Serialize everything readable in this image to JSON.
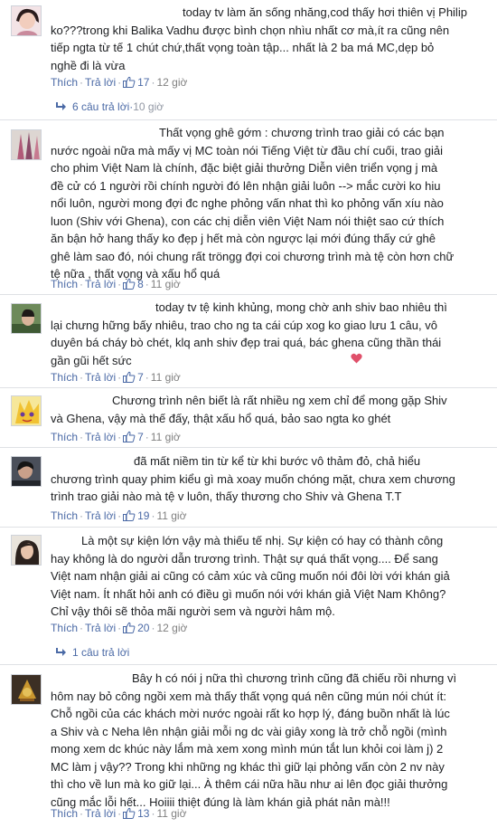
{
  "comments": [
    {
      "text": "today tv làm ăn sống nhăng,cod thấy hơi thiên vị Philip\nko???trong khi Balika Vadhu được bình chọn nhìu nhất cơ mà,ít ra cũng nên\ntiếp ngta từ tế 1 chút chứ,thất vọng toàn tập... nhất là 2 ba má MC,dẹp bỏ\nnghề đi là vừa",
      "like": "Thích",
      "reply": "Trả lời",
      "likes": "17",
      "time": "12 giờ",
      "replies": "6 câu trả lời",
      "replies_time": "10 giờ"
    },
    {
      "text": "Thất vọng ghê gớm : chương trình trao giải có các bạn\nnước ngoài nữa mà mấy vị MC toàn nói Tiếng Việt từ đầu chí cuối, trao giải\ncho phim Việt Nam là chính, đặc biệt giải thưởng Diễn viên triển vọng j mà\nđề cử có 1 người rồi chính người đó lên nhận giải luôn --> mắc cười ko hiu\nnổi luôn, người mong đợi đc nghe phỏng vấn nhat thì ko phỏng vấn xíu nào\nluon (Shiv với Ghena), con các chị diễn viên Việt Nam nói thiệt sao cứ thích\năn bận hở hang thấy ko đẹp j hết mà còn ngược lại mới đúng thấy cứ ghê\nghê làm sao đó, nói chung rất tröngg đợi coi chương trình mà tệ còn hơn chữ\ntệ nữa , thất vọng và xấu hổ quá",
      "like": "Thích",
      "reply": "Trả lời",
      "likes": "8",
      "time": "11 giờ"
    },
    {
      "text": "today tv tệ kinh khủng, mong chờ anh shiv bao nhiêu thì\nlại chưng hững bấy nhiêu, trao cho ng ta cái cúp xog ko giao lưu 1 câu, vô\nduyên bá cháy bò chét, klq anh shiv đẹp trai quá, bác ghena cũng thần thái\ngần gũi hết sức",
      "like": "Thích",
      "reply": "Trả lời",
      "likes": "7",
      "time": "11 giờ"
    },
    {
      "text": "Chương trình nên biết là rất nhiều ng xem chỉ để mong gặp Shiv\nvà Ghena, vậy mà thế đấy, thật xấu hổ quá, bảo sao ngta ko ghét",
      "like": "Thích",
      "reply": "Trả lời",
      "likes": "7",
      "time": "11 giờ"
    },
    {
      "text": "đã mất niềm tin từ kể từ khi bước vô thảm đỏ, chả hiểu\nchương trình quay phim kiểu gì mà xoay muốn chóng mặt, chưa xem chương\ntrình trao giải nào mà tệ v luôn, thấy thương cho Shiv và Ghena T.T",
      "like": "Thích",
      "reply": "Trả lời",
      "likes": "19",
      "time": "11 giờ"
    },
    {
      "text": "Là một sự kiện lớn vậy mà thiếu tế nhị. Sự kiện có hay có thành công\nhay không là do người dẫn trương trình. Thật sự quá thất vọng.... Để sang\nViệt nam nhận giải ai cũng có cảm xúc và cũng muốn nói đôi lời với khán giả\nViệt nam. Ít nhất hỏi anh có điều gì muốn nói với khán giả Việt Nam Không?\nChỉ vậy thôi sẽ thỏa mãi người sem và người hâm mộ.",
      "like": "Thích",
      "reply": "Trả lời",
      "likes": "20",
      "time": "12 giờ",
      "replies": "1 câu trả lời",
      "replies_time": ""
    },
    {
      "text": "Bây h có nói j nữa thì chương trình cũng đã chiếu rồi nhưng vì\nhôm nay bỏ công ngồi xem mà thấy thất vọng quá nên cũng mún nói chút ít:\nChỗ ngồi của các khách mời nước ngoài rất ko hợp lý, đáng buồn nhất là lúc\na Shiv và c Neha lên nhận giải mỗi ng dc vài giây xong là trở chỗ ngồi (mình\nmong xem dc khúc này lắm mà xem xong mình mún tắt lun khỏi coi làm j) 2\nMC làm j vậy?? Trong khi những ng khác thì giữ lại phỏng vấn còn 2 nv này\nthì cho về lun mà ko giữ lại... À thêm cái nữa hầu như ai lên đọc giải thưởng\ncũng mắc lỗi hết... Hoiiii thiệt đúng là làm khán giả phát nản mà!!!",
      "like": "Thích",
      "reply": "Trả lời",
      "likes": "13",
      "time": "11 giờ"
    }
  ]
}
